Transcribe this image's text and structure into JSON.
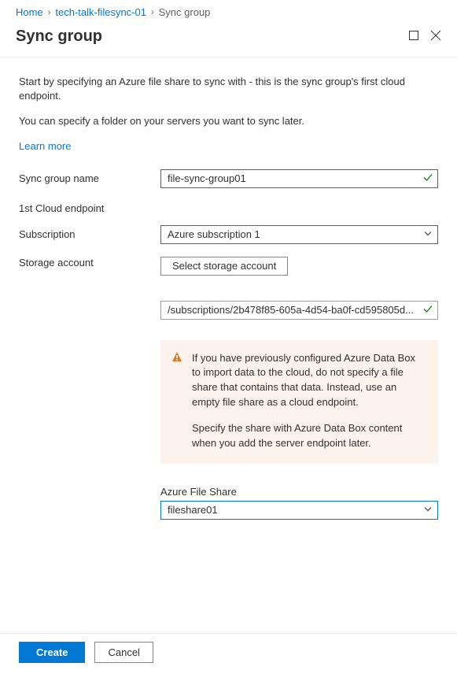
{
  "breadcrumb": {
    "home": "Home",
    "service": "tech-talk-filesync-01",
    "current": "Sync group"
  },
  "header": {
    "title": "Sync group"
  },
  "intro": {
    "p1": "Start by specifying an Azure file share to sync with - this is the sync group's first cloud endpoint.",
    "p2": "You can specify a folder on your servers you want to sync later.",
    "learn_more": "Learn more"
  },
  "form": {
    "sync_group_name_label": "Sync group name",
    "sync_group_name_value": "file-sync-group01",
    "cloud_endpoint_title": "1st Cloud endpoint",
    "subscription_label": "Subscription",
    "subscription_value": "Azure subscription 1",
    "storage_account_label": "Storage account",
    "select_storage_btn": "Select storage account",
    "storage_path_value": "/subscriptions/2b478f85-605a-4d54-ba0f-cd595805d...",
    "warning_p1": "If you have previously configured Azure Data Box to import data to the cloud, do not specify a file share that contains that data. Instead, use an empty file share as a cloud endpoint.",
    "warning_p2": "Specify the share with Azure Data Box content when you add the server endpoint later.",
    "file_share_label": "Azure File Share",
    "file_share_value": "fileshare01"
  },
  "footer": {
    "create": "Create",
    "cancel": "Cancel"
  }
}
